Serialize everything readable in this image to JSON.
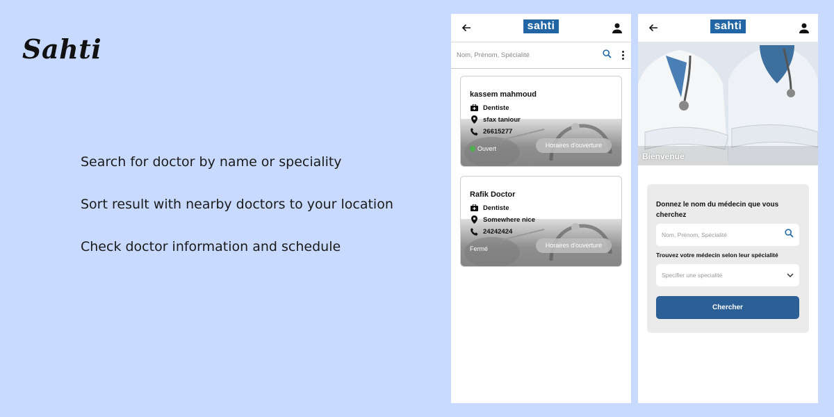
{
  "brand": "Sahti",
  "features": [
    "Search for doctor by name or speciality",
    "Sort result with nearby doctors to your location",
    "Check doctor information and schedule"
  ],
  "app": {
    "logo": "sahti",
    "accent": "#2165a5"
  },
  "results_screen": {
    "search_placeholder": "Nom, Prénom, Spécialité",
    "doctors": [
      {
        "name": "kassem mahmoud",
        "speciality": "Dentiste",
        "location": "sfax taniour",
        "phone": "26615277",
        "status": "Ouvert",
        "hours_button": "Horaires d'ouverture"
      },
      {
        "name": "Rafik Doctor",
        "speciality": "Dentiste",
        "location": "Somewhere nice",
        "phone": "24242424",
        "status": "Fermé",
        "hours_button": "Horaires d'ouverture"
      }
    ]
  },
  "home_screen": {
    "welcome": "Bienvenue",
    "question": "Donnez le nom du médecin que vous cherchez",
    "search_placeholder": "Nom, Prénom, Spécialité",
    "speciality_label": "Trouvez votre médecin selon leur spécialité",
    "speciality_placeholder": "Specifier une specialité",
    "submit": "Chercher",
    "button_color": "#2b5f96"
  }
}
